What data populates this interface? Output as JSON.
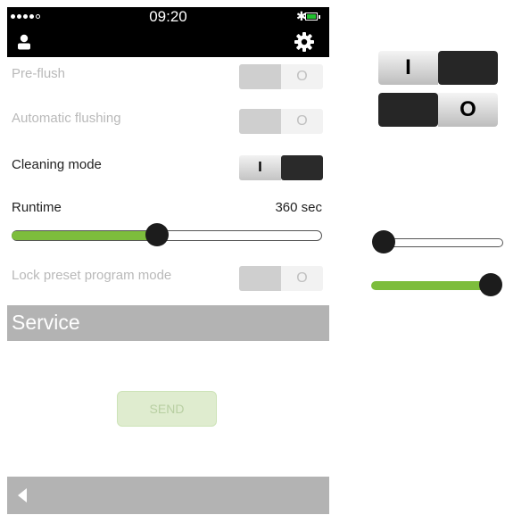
{
  "status_bar": {
    "time": "09:20"
  },
  "settings": {
    "pre_flush": {
      "label": "Pre-flush",
      "state_glyph": "O",
      "on": false,
      "enabled": false
    },
    "automatic_flushing": {
      "label": "Automatic flushing",
      "state_glyph": "O",
      "on": false,
      "enabled": false
    },
    "cleaning_mode": {
      "label": "Cleaning mode",
      "state_glyph": "I",
      "on": true,
      "enabled": true
    },
    "runtime": {
      "label": "Runtime",
      "value_text": "360 sec",
      "slider_fraction": 0.47
    },
    "lock_preset": {
      "label": "Lock preset program mode",
      "state_glyph": "O",
      "on": false,
      "enabled": false
    }
  },
  "service": {
    "title": "Service",
    "send_label": "SEND"
  },
  "samples": {
    "toggle_on_glyph": "I",
    "toggle_off_glyph": "O",
    "slider_empty_fraction": 0.0,
    "slider_full_fraction": 1.0
  },
  "colors": {
    "accent_green": "#7dbd3c",
    "bar_gray": "#b3b3b3",
    "header_black": "#000000"
  },
  "icons": [
    "user-icon",
    "gear-icon",
    "bluetooth-icon",
    "battery-icon",
    "back-icon"
  ]
}
